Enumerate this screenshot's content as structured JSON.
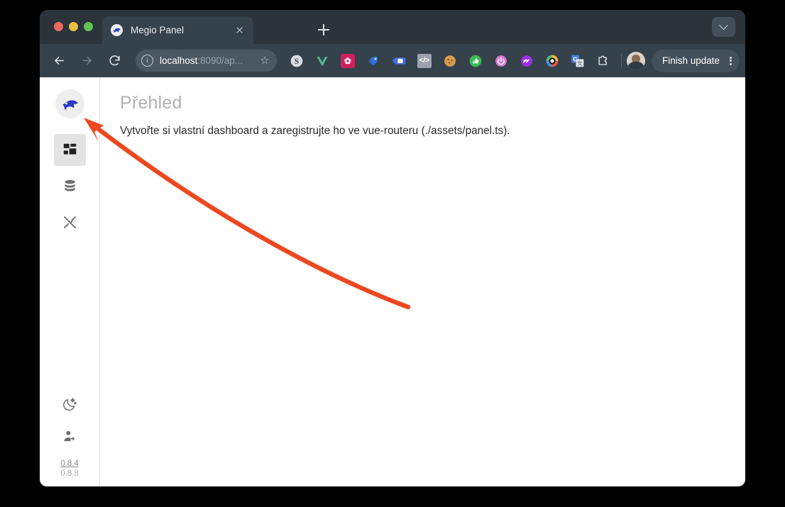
{
  "window": {
    "traffic_lights": [
      "close",
      "minimize",
      "maximize"
    ]
  },
  "browser": {
    "tab": {
      "title": "Megio Panel",
      "favicon": "shark-logo-icon",
      "close_label": "×"
    },
    "new_tab_label": "+",
    "tab_list_label": "▾",
    "nav": {
      "back_label": "←",
      "forward_label": "→",
      "reload_label": "⟳"
    },
    "omnibox": {
      "info_label": "i",
      "url_host": "localhost",
      "url_path": ":8090/ap...",
      "bookmark_label": "☆"
    },
    "extensions": [
      {
        "name": "grammarly-extension-icon",
        "glyph": "S",
        "color": "#a8b0b6",
        "bg": "transparent"
      },
      {
        "name": "vue-devtools-icon",
        "glyph": "V",
        "color": "#4fbf8b",
        "bg": "transparent"
      },
      {
        "name": "flower-extension-icon",
        "glyph": "✿",
        "color": "#ffffff",
        "bg": "#cf1f5e"
      },
      {
        "name": "tag-extension-icon",
        "glyph": "◗",
        "color": "#2f6fe0",
        "bg": "transparent"
      },
      {
        "name": "bookmark-tag-icon",
        "glyph": "B",
        "color": "#ffffff",
        "bg": "#3a6fd8"
      },
      {
        "name": "code-brackets-icon",
        "glyph": "</>",
        "color": "#ffffff",
        "bg": "#9aa3ab"
      },
      {
        "name": "cookie-extension-icon",
        "glyph": "●",
        "color": "#d99a4e",
        "bg": "transparent"
      },
      {
        "name": "thumbs-up-extension-icon",
        "glyph": "👍",
        "color": "#ffffff",
        "bg": "#3cba54"
      },
      {
        "name": "power-extension-icon",
        "glyph": "⏻",
        "color": "#ffffff",
        "bg": "#d978d4"
      },
      {
        "name": "infinity-extension-icon",
        "glyph": "∞",
        "color": "#ffffff",
        "bg": "#9b2fe8"
      },
      {
        "name": "camera-ring-extension-icon",
        "glyph": "◎",
        "color": "#ffffff",
        "bg": "#222222"
      },
      {
        "name": "google-translate-icon",
        "glyph": "G",
        "color": "#ffffff",
        "bg": "#4a7fd6"
      },
      {
        "name": "extensions-puzzle-icon",
        "glyph": "⬡",
        "color": "#e7ecef",
        "bg": "transparent"
      }
    ],
    "profile": {
      "name": "user-avatar"
    },
    "update_button": {
      "label": "Finish update",
      "menu_label": "⋮"
    }
  },
  "app": {
    "logo_name": "megio-shark-logo",
    "sidebar": {
      "items": [
        {
          "name": "sidebar-item-dashboard",
          "icon": "dashboard-grid-icon",
          "active": true
        },
        {
          "name": "sidebar-item-database",
          "icon": "database-icon",
          "active": false
        },
        {
          "name": "sidebar-item-tools",
          "icon": "tools-hammer-wrench-icon",
          "active": false
        }
      ],
      "bottom_items": [
        {
          "name": "sidebar-item-dark-mode",
          "icon": "moon-stars-icon"
        },
        {
          "name": "sidebar-item-logout",
          "icon": "user-logout-icon"
        }
      ],
      "version_new": "0.8.4",
      "version_current": "0.8.8"
    },
    "main": {
      "title": "Přehled",
      "description": "Vytvořte si vlastní dashboard a zaregistrujte ho ve vue-routeru (./assets/panel.ts)."
    }
  },
  "annotation": {
    "name": "red-arrow-pointing-to-logo",
    "color": "#ED4820",
    "points_to": "megio-shark-logo"
  }
}
